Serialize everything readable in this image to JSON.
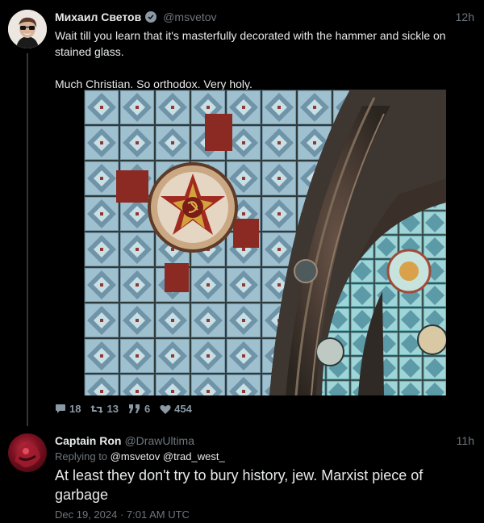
{
  "post": {
    "author_name": "Михаил Светов",
    "author_handle": "@msvetov",
    "time": "12h",
    "text_lines": [
      "Wait till you learn that it's masterfully decorated with the hammer and sickle on stained glass.",
      "Much Christian. So orthodox. Very holy."
    ],
    "stats": {
      "replies": "18",
      "retweets": "13",
      "quotes": "6",
      "likes": "454"
    }
  },
  "reply": {
    "author_name": "Captain Ron",
    "author_handle": "@DrawUltima",
    "time": "11h",
    "replying_prefix": "Replying to",
    "replying_to": "@msvetov @trad_west_",
    "text": "At least they don't try to bury history, jew. Marxist piece of garbage",
    "date": "Dec 19, 2024 · 7:01 AM UTC"
  },
  "icons": {
    "verified": "verified-badge-icon",
    "reply": "comment-icon",
    "retweet": "retweet-icon",
    "quote": "quote-icon",
    "like": "heart-icon"
  },
  "colors": {
    "background": "#000000",
    "text": "#e7e9ea",
    "muted": "#6e767d",
    "thread_line": "#333639"
  }
}
